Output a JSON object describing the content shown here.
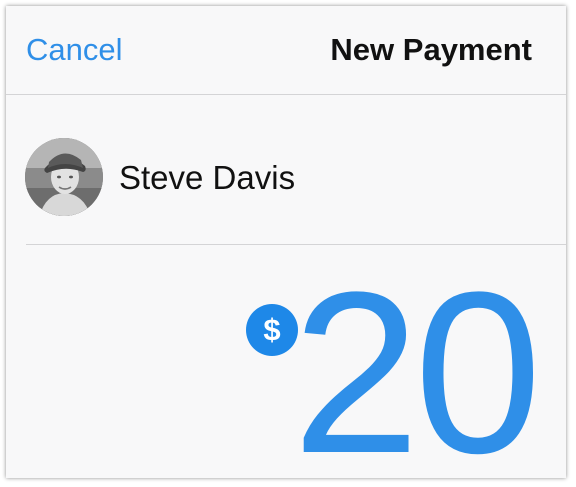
{
  "nav": {
    "cancel_label": "Cancel",
    "title": "New Payment"
  },
  "recipient": {
    "name": "Steve Davis",
    "avatar_icon": "user-avatar-photo"
  },
  "payment": {
    "currency_symbol": "$",
    "amount": "20"
  },
  "colors": {
    "accent": "#2f8fe8",
    "currency_badge": "#1e88e8",
    "divider": "#d4d4d6",
    "background": "#f8f8f9"
  }
}
